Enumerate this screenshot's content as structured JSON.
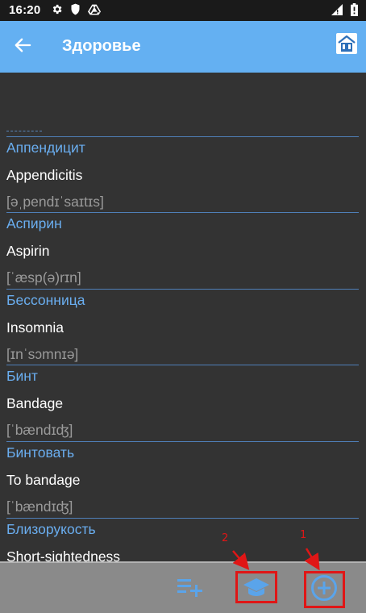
{
  "status_bar": {
    "time": "16:20",
    "icons_left": [
      "gear-icon",
      "shield-icon",
      "drive-icon"
    ],
    "icons_right": [
      "signal-icon",
      "battery-icon"
    ]
  },
  "app_bar": {
    "title": "Здоровье",
    "color": "#64b0f2",
    "back_icon": "arrow-left-icon",
    "home_icon": "home-icon"
  },
  "words": [
    {
      "ru": "Аппендицит",
      "en": "Appendicitis",
      "transcription": "[əˌpendɪˈsaɪtɪs]"
    },
    {
      "ru": "Аспирин",
      "en": "Aspirin",
      "transcription": "[ˈæsp(ə)rɪn]"
    },
    {
      "ru": "Бессонница",
      "en": "Insomnia",
      "transcription": "[ɪnˈsɔmnɪə]"
    },
    {
      "ru": "Бинт",
      "en": "Bandage",
      "transcription": "[ˈbændɪʤ]"
    },
    {
      "ru": "Бинтовать",
      "en": "To bandage",
      "transcription": "[ˈbændɪʤ]"
    },
    {
      "ru": "Близорукость",
      "en": "Short-sightedness",
      "transcription": ""
    }
  ],
  "bottom_bar": {
    "buttons": [
      {
        "name": "add-to-list-button",
        "icon": "playlist-add-icon"
      },
      {
        "name": "study-button",
        "icon": "graduation-cap-icon"
      },
      {
        "name": "add-word-button",
        "icon": "plus-circle-icon"
      }
    ]
  },
  "annotations": {
    "labels": [
      "2",
      "1"
    ],
    "color": "#e01616"
  }
}
